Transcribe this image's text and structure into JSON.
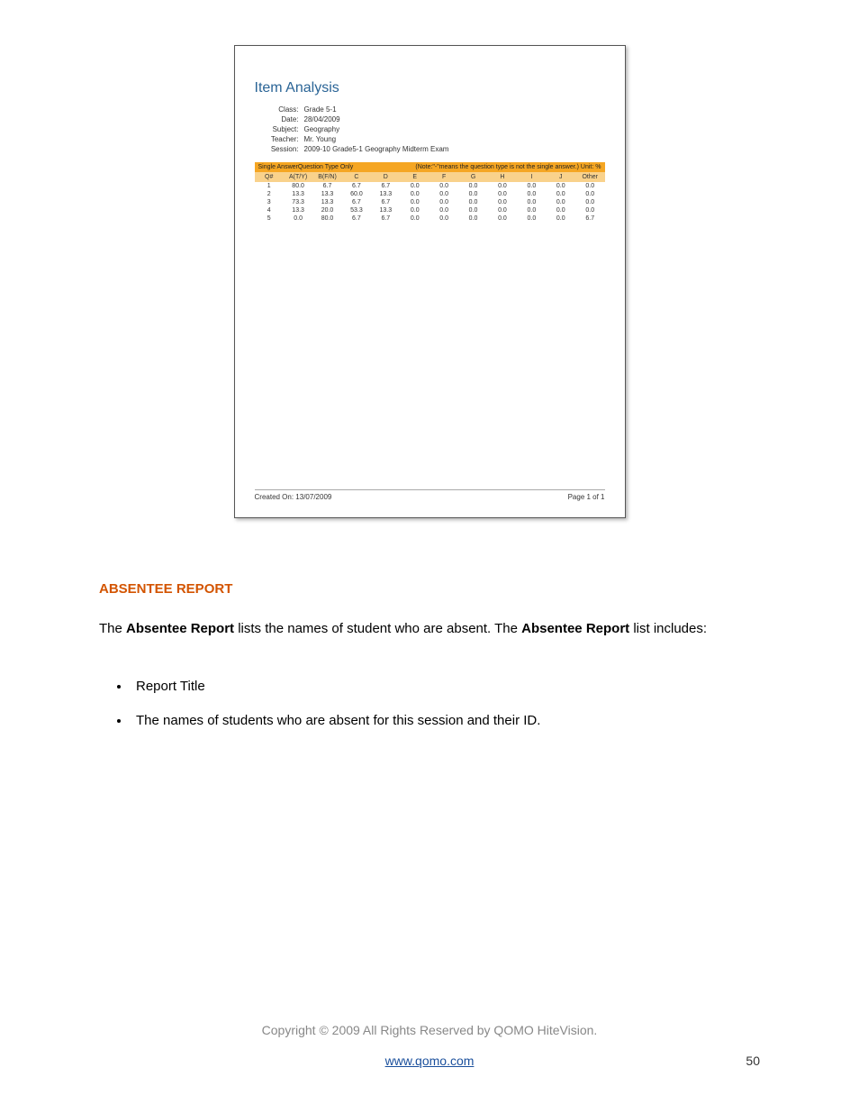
{
  "report": {
    "title": "Item Analysis",
    "meta": {
      "class_label": "Class:",
      "class_value": "Grade 5-1",
      "date_label": "Date:",
      "date_value": "28/04/2009",
      "subject_label": "Subject:",
      "subject_value": "Geography",
      "teacher_label": "Teacher:",
      "teacher_value": "Mr. Young",
      "session_label": "Session:",
      "session_value": "2009-10 Grade5-1 Geography Midterm Exam"
    },
    "table_head_left": "Single AnswerQuestion Type Only",
    "table_head_right": "(Note:\"-\"means the question type is not the single answer.)   Unit: %",
    "columns": [
      "Q#",
      "A(T/Y)",
      "B(F/N)",
      "C",
      "D",
      "E",
      "F",
      "G",
      "H",
      "I",
      "J",
      "Other"
    ],
    "rows": [
      [
        "1",
        "80.0",
        "6.7",
        "6.7",
        "6.7",
        "0.0",
        "0.0",
        "0.0",
        "0.0",
        "0.0",
        "0.0",
        "0.0"
      ],
      [
        "2",
        "13.3",
        "13.3",
        "60.0",
        "13.3",
        "0.0",
        "0.0",
        "0.0",
        "0.0",
        "0.0",
        "0.0",
        "0.0"
      ],
      [
        "3",
        "73.3",
        "13.3",
        "6.7",
        "6.7",
        "0.0",
        "0.0",
        "0.0",
        "0.0",
        "0.0",
        "0.0",
        "0.0"
      ],
      [
        "4",
        "13.3",
        "20.0",
        "53.3",
        "13.3",
        "0.0",
        "0.0",
        "0.0",
        "0.0",
        "0.0",
        "0.0",
        "0.0"
      ],
      [
        "5",
        "0.0",
        "80.0",
        "6.7",
        "6.7",
        "0.0",
        "0.0",
        "0.0",
        "0.0",
        "0.0",
        "0.0",
        "6.7"
      ]
    ],
    "created_on": "Created On: 13/07/2009",
    "page_of": "Page 1 of 1"
  },
  "section_heading": "ABSENTEE REPORT",
  "paragraph": {
    "p1": "The ",
    "b1": "Absentee Report",
    "p2": " lists the names of student who are absent. The ",
    "b2": "Absentee Report",
    "p3": " list includes:"
  },
  "bullets": [
    "Report Title",
    "The names of students who are absent for this session and their ID."
  ],
  "footer": {
    "copyright": "Copyright © 2009 All Rights Reserved by QOMO HiteVision.",
    "url": "www.qomo.com",
    "pagenum": "50"
  },
  "chart_data": {
    "type": "table",
    "title": "Item Analysis — Single Answer Question Type Only (Unit: %)",
    "columns": [
      "Q#",
      "A(T/Y)",
      "B(F/N)",
      "C",
      "D",
      "E",
      "F",
      "G",
      "H",
      "I",
      "J",
      "Other"
    ],
    "rows": [
      {
        "Q#": 1,
        "A(T/Y)": 80.0,
        "B(F/N)": 6.7,
        "C": 6.7,
        "D": 6.7,
        "E": 0.0,
        "F": 0.0,
        "G": 0.0,
        "H": 0.0,
        "I": 0.0,
        "J": 0.0,
        "Other": 0.0
      },
      {
        "Q#": 2,
        "A(T/Y)": 13.3,
        "B(F/N)": 13.3,
        "C": 60.0,
        "D": 13.3,
        "E": 0.0,
        "F": 0.0,
        "G": 0.0,
        "H": 0.0,
        "I": 0.0,
        "J": 0.0,
        "Other": 0.0
      },
      {
        "Q#": 3,
        "A(T/Y)": 73.3,
        "B(F/N)": 13.3,
        "C": 6.7,
        "D": 6.7,
        "E": 0.0,
        "F": 0.0,
        "G": 0.0,
        "H": 0.0,
        "I": 0.0,
        "J": 0.0,
        "Other": 0.0
      },
      {
        "Q#": 4,
        "A(T/Y)": 13.3,
        "B(F/N)": 20.0,
        "C": 53.3,
        "D": 13.3,
        "E": 0.0,
        "F": 0.0,
        "G": 0.0,
        "H": 0.0,
        "I": 0.0,
        "J": 0.0,
        "Other": 0.0
      },
      {
        "Q#": 5,
        "A(T/Y)": 0.0,
        "B(F/N)": 80.0,
        "C": 6.7,
        "D": 6.7,
        "E": 0.0,
        "F": 0.0,
        "G": 0.0,
        "H": 0.0,
        "I": 0.0,
        "J": 0.0,
        "Other": 6.7
      }
    ]
  }
}
